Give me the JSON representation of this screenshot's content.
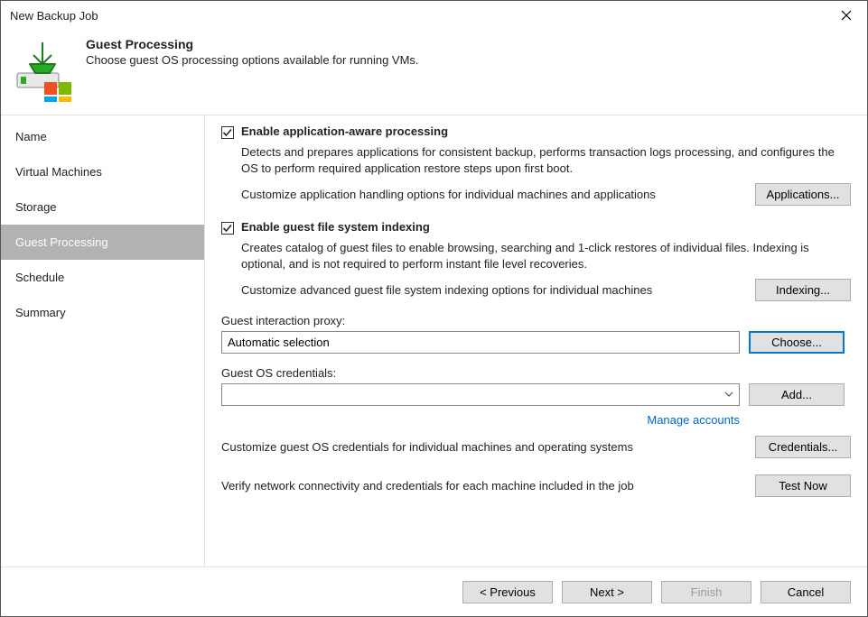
{
  "window": {
    "title": "New Backup Job"
  },
  "header": {
    "heading": "Guest Processing",
    "subtitle": "Choose guest OS processing options available for running VMs."
  },
  "nav": {
    "items": [
      {
        "label": "Name"
      },
      {
        "label": "Virtual Machines"
      },
      {
        "label": "Storage"
      },
      {
        "label": "Guest Processing"
      },
      {
        "label": "Schedule"
      },
      {
        "label": "Summary"
      }
    ]
  },
  "content": {
    "appAware": {
      "label": "Enable application-aware processing",
      "desc": "Detects and prepares applications for consistent backup, performs transaction logs processing, and configures the OS to perform required application restore steps upon first boot.",
      "customize": "Customize application handling options for individual machines and applications",
      "btn": "Applications..."
    },
    "indexing": {
      "label": "Enable guest file system indexing",
      "desc": "Creates catalog of guest files to enable browsing, searching and 1-click restores of individual files. Indexing is optional, and is not required to perform instant file level recoveries.",
      "customize": "Customize advanced guest file system indexing options for individual machines",
      "btn": "Indexing..."
    },
    "proxy": {
      "label": "Guest interaction proxy:",
      "value": "Automatic selection",
      "btn": "Choose..."
    },
    "creds": {
      "label": "Guest OS credentials:",
      "value": "",
      "btn": "Add...",
      "link": "Manage accounts",
      "customize": "Customize guest OS credentials for individual machines and operating systems",
      "credBtn": "Credentials..."
    },
    "verify": {
      "text": "Verify network connectivity and credentials for each machine included in the job",
      "btn": "Test Now"
    }
  },
  "footer": {
    "previous": "< Previous",
    "next": "Next >",
    "finish": "Finish",
    "cancel": "Cancel"
  }
}
